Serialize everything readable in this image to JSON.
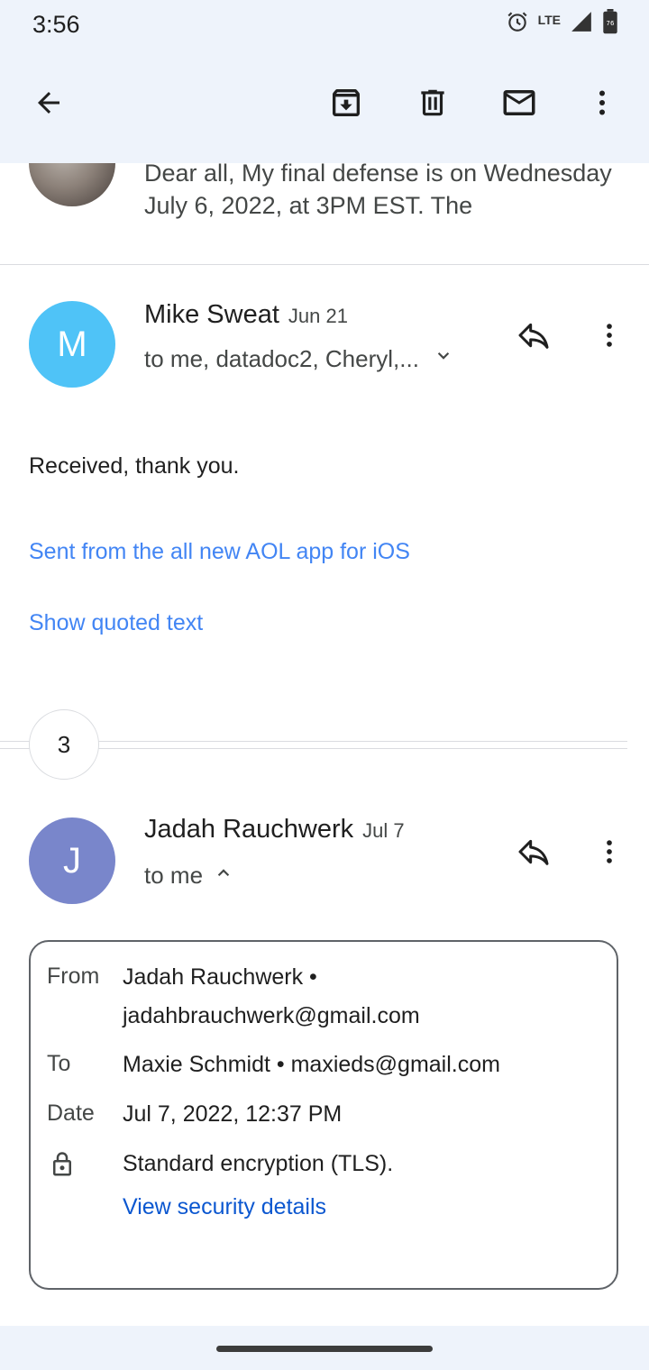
{
  "status_bar": {
    "time": "3:56",
    "network": "LTE",
    "battery": "76"
  },
  "toolbar": {
    "icons": [
      "back-arrow-icon",
      "archive-icon",
      "delete-icon",
      "mark-unread-icon",
      "more-vert-icon"
    ]
  },
  "previous_message": {
    "preview": "Dear all, My final defense is on Wednesday July 6, 2022, at 3PM EST. The"
  },
  "message_mike": {
    "avatar_letter": "M",
    "avatar_color": "#4fc3f7",
    "sender": "Mike Sweat",
    "date": "Jun 21",
    "recipients": "to me, datadoc2, Cheryl,...",
    "body": "Received, thank you.",
    "signature_link": "Sent from the all new AOL app for iOS",
    "show_quoted": "Show quoted text"
  },
  "collapsed_count": "3",
  "message_jadah": {
    "avatar_letter": "J",
    "avatar_color": "#7986cb",
    "sender": "Jadah Rauchwerk",
    "date": "Jul 7",
    "recipients": "to me",
    "details": {
      "from_label": "From",
      "from_name": "Jadah Rauchwerk •",
      "from_email": "jadahbrauchwerk@gmail.com",
      "to_label": "To",
      "to_value": "Maxie Schmidt • maxieds@gmail.com",
      "date_label": "Date",
      "date_value": "Jul 7, 2022, 12:37 PM",
      "encryption": "Standard encryption (TLS).",
      "security_link": "View security details"
    }
  },
  "colors": {
    "accent_link": "#4285f4",
    "security_link": "#0b57d0",
    "header_bg": "#eef3fb"
  }
}
